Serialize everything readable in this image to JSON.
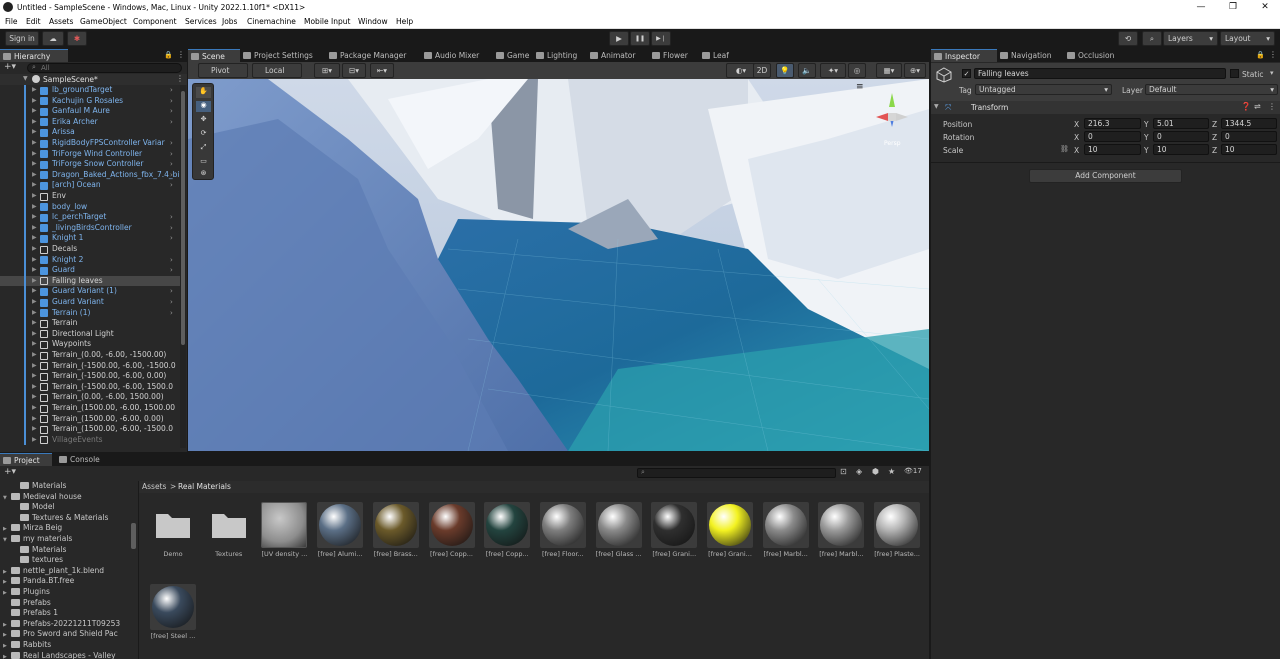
{
  "window": {
    "title": "Untitled - SampleScene - Windows, Mac, Linux - Unity 2022.1.10f1* <DX11>",
    "controls": [
      "—",
      "❐",
      "✕"
    ]
  },
  "menu": [
    "File",
    "Edit",
    "Assets",
    "GameObject",
    "Component",
    "Services",
    "Jobs",
    "Cinemachine",
    "Mobile Input",
    "Window",
    "Help"
  ],
  "toolbar": {
    "sign_in": "Sign in",
    "play": "▶",
    "pause": "❚❚",
    "step": "▶❘",
    "layers": "Layers",
    "layout": "Layout"
  },
  "hierarchy": {
    "tab": "Hierarchy",
    "search_placeholder": "All",
    "scene": "SampleScene*",
    "items": [
      {
        "label": "lb_groundTarget",
        "type": "prefab",
        "chev": true
      },
      {
        "label": "Kachujin G Rosales",
        "type": "prefab",
        "chev": true
      },
      {
        "label": "Ganfaul M Aure",
        "type": "prefab",
        "chev": true
      },
      {
        "label": "Erika Archer",
        "type": "prefab",
        "chev": true
      },
      {
        "label": "Arissa",
        "type": "prefab",
        "chev": false
      },
      {
        "label": "RigidBodyFPSController Variar",
        "type": "prefab",
        "chev": true
      },
      {
        "label": "TriForge Wind Controller",
        "type": "prefab",
        "chev": true
      },
      {
        "label": "TriForge Snow Controller",
        "type": "prefab",
        "chev": true
      },
      {
        "label": "Dragon_Baked_Actions_fbx_7.4_bi",
        "type": "prefab",
        "chev": true
      },
      {
        "label": "[arch] Ocean",
        "type": "prefab",
        "chev": true
      },
      {
        "label": "Env",
        "type": "normal",
        "chev": false
      },
      {
        "label": "body_low",
        "type": "prefab",
        "chev": false
      },
      {
        "label": "lc_perchTarget",
        "type": "prefab",
        "chev": true
      },
      {
        "label": "_livingBirdsController",
        "type": "prefab",
        "chev": true
      },
      {
        "label": "Knight 1",
        "type": "prefab",
        "chev": true
      },
      {
        "label": "Decals",
        "type": "normal",
        "chev": false
      },
      {
        "label": "Knight 2",
        "type": "prefab",
        "chev": true
      },
      {
        "label": "Guard",
        "type": "prefab",
        "chev": true
      },
      {
        "label": "Falling leaves",
        "type": "normal",
        "chev": false,
        "selected": true
      },
      {
        "label": "Guard Variant (1)",
        "type": "prefab",
        "chev": true
      },
      {
        "label": "Guard Variant",
        "type": "prefab",
        "chev": true
      },
      {
        "label": "Terrain (1)",
        "type": "prefab",
        "chev": true
      },
      {
        "label": "Terrain",
        "type": "normal",
        "chev": false
      },
      {
        "label": "Directional Light",
        "type": "normal",
        "chev": false
      },
      {
        "label": "Waypoints",
        "type": "normal",
        "chev": false
      },
      {
        "label": "Terrain_(0.00, -6.00, -1500.00)",
        "type": "normal",
        "chev": false
      },
      {
        "label": "Terrain_(-1500.00, -6.00, -1500.0",
        "type": "normal",
        "chev": false
      },
      {
        "label": "Terrain_(-1500.00, -6.00, 0.00)",
        "type": "normal",
        "chev": false
      },
      {
        "label": "Terrain_(-1500.00, -6.00, 1500.0",
        "type": "normal",
        "chev": false
      },
      {
        "label": "Terrain_(0.00, -6.00, 1500.00)",
        "type": "normal",
        "chev": false
      },
      {
        "label": "Terrain_(1500.00, -6.00, 1500.00",
        "type": "normal",
        "chev": false
      },
      {
        "label": "Terrain_(1500.00, -6.00, 0.00)",
        "type": "normal",
        "chev": false
      },
      {
        "label": "Terrain_(1500.00, -6.00, -1500.0",
        "type": "normal",
        "chev": false
      },
      {
        "label": "VillageEvents",
        "type": "dim",
        "chev": false
      }
    ]
  },
  "scene_tabs": [
    "Scene",
    "Project Settings",
    "Package Manager",
    "Audio Mixer",
    "Game",
    "Lighting",
    "Animator",
    "Flower",
    "Leaf"
  ],
  "scene_toolbar": {
    "pivot": "Pivot",
    "local": "Local",
    "mode_2d": "2D"
  },
  "inspector": {
    "tabs": [
      "Inspector",
      "Navigation",
      "Occlusion"
    ],
    "object_name": "Falling leaves",
    "static_label": "Static",
    "tag_label": "Tag",
    "tag_value": "Untagged",
    "layer_label": "Layer",
    "layer_value": "Default",
    "transform": {
      "title": "Transform",
      "position": {
        "label": "Position",
        "x": "216.3",
        "y": "5.01",
        "z": "1344.5"
      },
      "rotation": {
        "label": "Rotation",
        "x": "0",
        "y": "0",
        "z": "0"
      },
      "scale": {
        "label": "Scale",
        "x": "10",
        "y": "10",
        "z": "10"
      }
    },
    "add_component": "Add Component",
    "axis_x": "X",
    "axis_y": "Y",
    "axis_z": "Z"
  },
  "project": {
    "tabs": [
      "Project",
      "Console"
    ],
    "hidden_count": "17",
    "breadcrumb_root": "Assets",
    "breadcrumb_sep": ">",
    "breadcrumb_current": "Real Materials",
    "tree": [
      {
        "label": "Materials",
        "indent": 2,
        "arrow": ""
      },
      {
        "label": "Medieval house",
        "indent": 1,
        "arrow": "▼"
      },
      {
        "label": "Model",
        "indent": 2,
        "arrow": ""
      },
      {
        "label": "Textures & Materials",
        "indent": 2,
        "arrow": ""
      },
      {
        "label": "Mirza Beig",
        "indent": 1,
        "arrow": "▶"
      },
      {
        "label": "my materials",
        "indent": 1,
        "arrow": "▼"
      },
      {
        "label": "Materials",
        "indent": 2,
        "arrow": ""
      },
      {
        "label": "textures",
        "indent": 2,
        "arrow": ""
      },
      {
        "label": "nettle_plant_1k.blend",
        "indent": 1,
        "arrow": "▶"
      },
      {
        "label": "Panda.BT.free",
        "indent": 1,
        "arrow": "▶"
      },
      {
        "label": "Plugins",
        "indent": 1,
        "arrow": "▶"
      },
      {
        "label": "Prefabs",
        "indent": 1,
        "arrow": ""
      },
      {
        "label": "Prefabs 1",
        "indent": 1,
        "arrow": ""
      },
      {
        "label": "Prefabs-20221211T09253",
        "indent": 1,
        "arrow": "▶"
      },
      {
        "label": "Pro Sword and Shield Pac",
        "indent": 1,
        "arrow": "▶"
      },
      {
        "label": "Rabbits",
        "indent": 1,
        "arrow": "▶"
      },
      {
        "label": "Real Landscapes - Valley",
        "indent": 1,
        "arrow": "▶"
      }
    ],
    "assets": [
      {
        "name": "Demo",
        "kind": "folder",
        "color": "#c8c8c8"
      },
      {
        "name": "Textures",
        "kind": "folder",
        "color": "#c8c8c8"
      },
      {
        "name": "[UV density ...",
        "kind": "box",
        "color": "#8d8d8d"
      },
      {
        "name": "[free] Alumi...",
        "kind": "sphere",
        "color": "#5b6f86"
      },
      {
        "name": "[free] Brass...",
        "kind": "sphere",
        "color": "#6b5a2a"
      },
      {
        "name": "[free] Copp...",
        "kind": "sphere",
        "color": "#6a3b2b"
      },
      {
        "name": "[free] Copp...",
        "kind": "sphere",
        "color": "#23443f"
      },
      {
        "name": "[free] Floor...",
        "kind": "sphere",
        "color": "#7e7e7e"
      },
      {
        "name": "[free] Glass ...",
        "kind": "sphere",
        "color": "#8a8a8a"
      },
      {
        "name": "[free] Grani...",
        "kind": "sphere",
        "color": "#2f2f2f"
      },
      {
        "name": "[free] Grani...",
        "kind": "sphere",
        "color": "#f3f221"
      },
      {
        "name": "[free] Marbl...",
        "kind": "sphere",
        "color": "#8b8b8b"
      },
      {
        "name": "[free] Marbl...",
        "kind": "sphere",
        "color": "#9a9a9a"
      },
      {
        "name": "[free] Plaste...",
        "kind": "sphere",
        "color": "#b3b3b3"
      },
      {
        "name": "[free] Steel ...",
        "kind": "sphere",
        "color": "#3a4a5d"
      }
    ]
  },
  "colors": {
    "accent": "#3a79bb",
    "prefab": "#7fb5ee",
    "panel": "#282828"
  }
}
